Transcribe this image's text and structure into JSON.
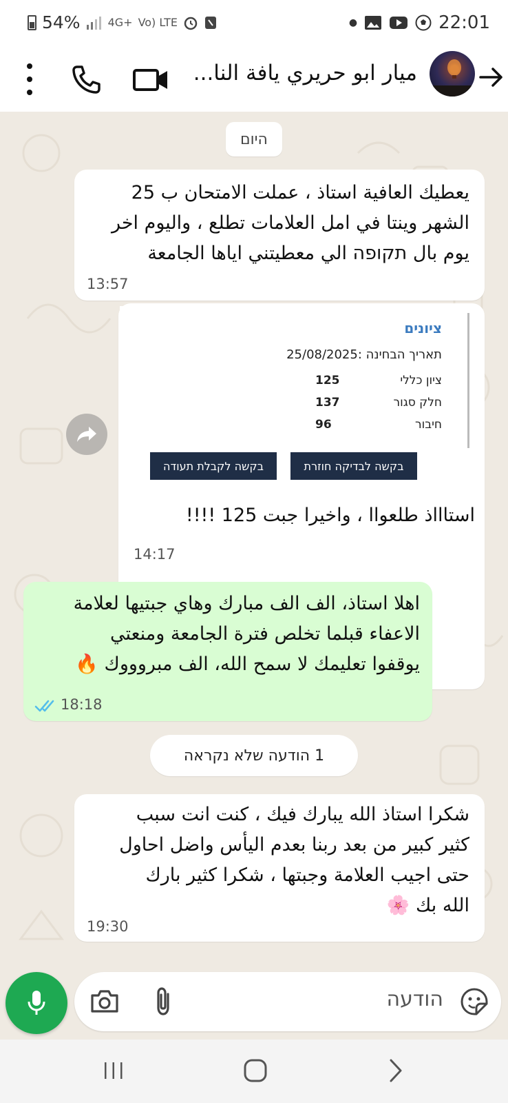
{
  "status_bar": {
    "battery": "54%",
    "network": "4G+",
    "volte": "Vo) LTE",
    "time": "22:01",
    "icons": [
      "battery-icon",
      "signal-icon",
      "network-4g-icon",
      "volte-icon",
      "alarm-icon",
      "nfc-icon",
      "dot-icon",
      "gallery-icon",
      "youtube-icon",
      "soccer-icon"
    ]
  },
  "header": {
    "contact_name": "ميار ابو حريري يافة النا...",
    "icons": [
      "more-vert-icon",
      "phone-icon",
      "video-call-icon",
      "avatar",
      "back-arrow-icon"
    ]
  },
  "chat": {
    "date_divider": "היום",
    "messages": [
      {
        "direction": "in",
        "lines": [
          "يعطيك العافية استاذ ، عملت الامتحان ب 25",
          "الشهر وينتا في امل العلامات تطلع  ، واليوم اخر",
          "يوم بال תקופה الي معطيتني اياها الجامعة"
        ],
        "time": "13:57"
      },
      {
        "direction": "in",
        "card": {
          "title": "ציונים",
          "exam_date": "תאריך הבחינה :25/08/2025",
          "rows": [
            {
              "label": "ציון כללי",
              "value": "125"
            },
            {
              "label": "חלק סגור",
              "value": "137"
            },
            {
              "label": "חיבור",
              "value": "96"
            }
          ],
          "buttons": [
            "בקשה לבדיקה חוזרת",
            "בקשה לקבלת תעודה"
          ]
        },
        "text": "استاااذ طلعواا ، واخيرا جبت 125 !!!!",
        "time": "14:17"
      },
      {
        "direction": "out",
        "lines": [
          "اهلا استاذ، الف الف مبارك وهاي جبتيها لعلامة",
          "الاعفاء قبلما تخلص فترة الجامعة ومنعتي",
          "يوقفوا تعليمك لا سمح الله، الف مبروووك 🔥"
        ],
        "time": "18:18",
        "status": "read"
      },
      {
        "direction": "in",
        "lines": [
          "شكرا استاذ الله يبارك فيك ، كنت انت سبب",
          "كثير كبير من بعد ربنا بعدم اليأس واضل احاول",
          "حتى اجيب العلامة وجبتها ، شكرا كثير بارك",
          "الله بك 🌸"
        ],
        "time": "19:30"
      }
    ],
    "unread_divider": "1 הודעה שלא נקראה"
  },
  "input": {
    "placeholder": "הודעה",
    "icons": [
      "emoji-sticker-icon",
      "attach-icon",
      "camera-icon",
      "mic-icon"
    ]
  },
  "nav": {
    "icons": [
      "recent-apps-icon",
      "home-icon",
      "back-icon"
    ]
  },
  "colors": {
    "chat_background": "#efeae2",
    "outgoing_bubble": "#d9fdd3",
    "incoming_bubble": "#ffffff",
    "mic_button": "#1ea952",
    "read_ticks": "#53bdeb",
    "card_button": "#1f2e46",
    "card_title": "#3b7bbf"
  }
}
